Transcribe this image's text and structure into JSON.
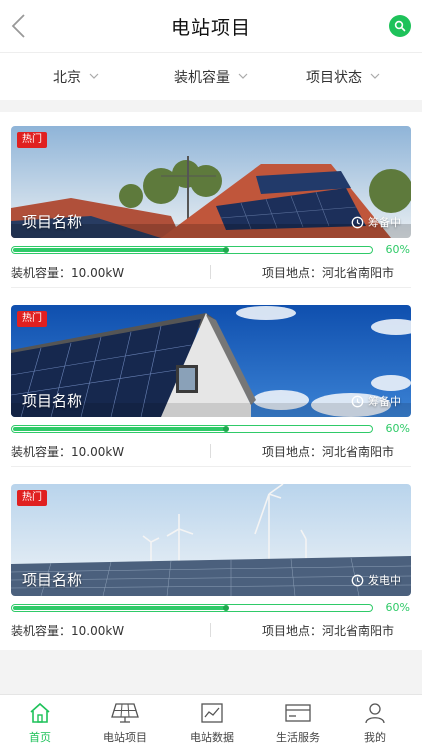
{
  "header": {
    "title": "电站项目",
    "back_icon": "chevron-left-icon",
    "search_icon": "search-icon"
  },
  "filters": [
    {
      "label": "北京"
    },
    {
      "label": "装机容量"
    },
    {
      "label": "项目状态"
    }
  ],
  "projects": [
    {
      "badge": "热门",
      "name": "项目名称",
      "status": "筹备中",
      "progress_text": "60%",
      "progress": 0.6,
      "capacity": "装机容量：10.00kW",
      "location": "项目地点：河北省南阳市",
      "image": "rooftop-solar-house"
    },
    {
      "badge": "热门",
      "name": "项目名称",
      "status": "筹备中",
      "progress_text": "60%",
      "progress": 0.6,
      "capacity": "装机容量：10.00kW",
      "location": "项目地点：河北省南阳市",
      "image": "roof-solar-sky"
    },
    {
      "badge": "热门",
      "name": "项目名称",
      "status": "发电中",
      "progress_text": "60%",
      "progress": 0.6,
      "capacity": "装机容量：10.00kW",
      "location": "项目地点：河北省南阳市",
      "image": "wind-solar-farm"
    }
  ],
  "tabbar": [
    {
      "label": "首页",
      "icon": "home-icon",
      "active": true
    },
    {
      "label": "电站项目",
      "icon": "solar-panel-icon",
      "active": false
    },
    {
      "label": "电站数据",
      "icon": "chart-icon",
      "active": false
    },
    {
      "label": "生活服务",
      "icon": "card-icon",
      "active": false
    },
    {
      "label": "我的",
      "icon": "user-icon",
      "active": false
    }
  ],
  "colors": {
    "accent": "#1ec25a",
    "badge": "#e02020"
  }
}
